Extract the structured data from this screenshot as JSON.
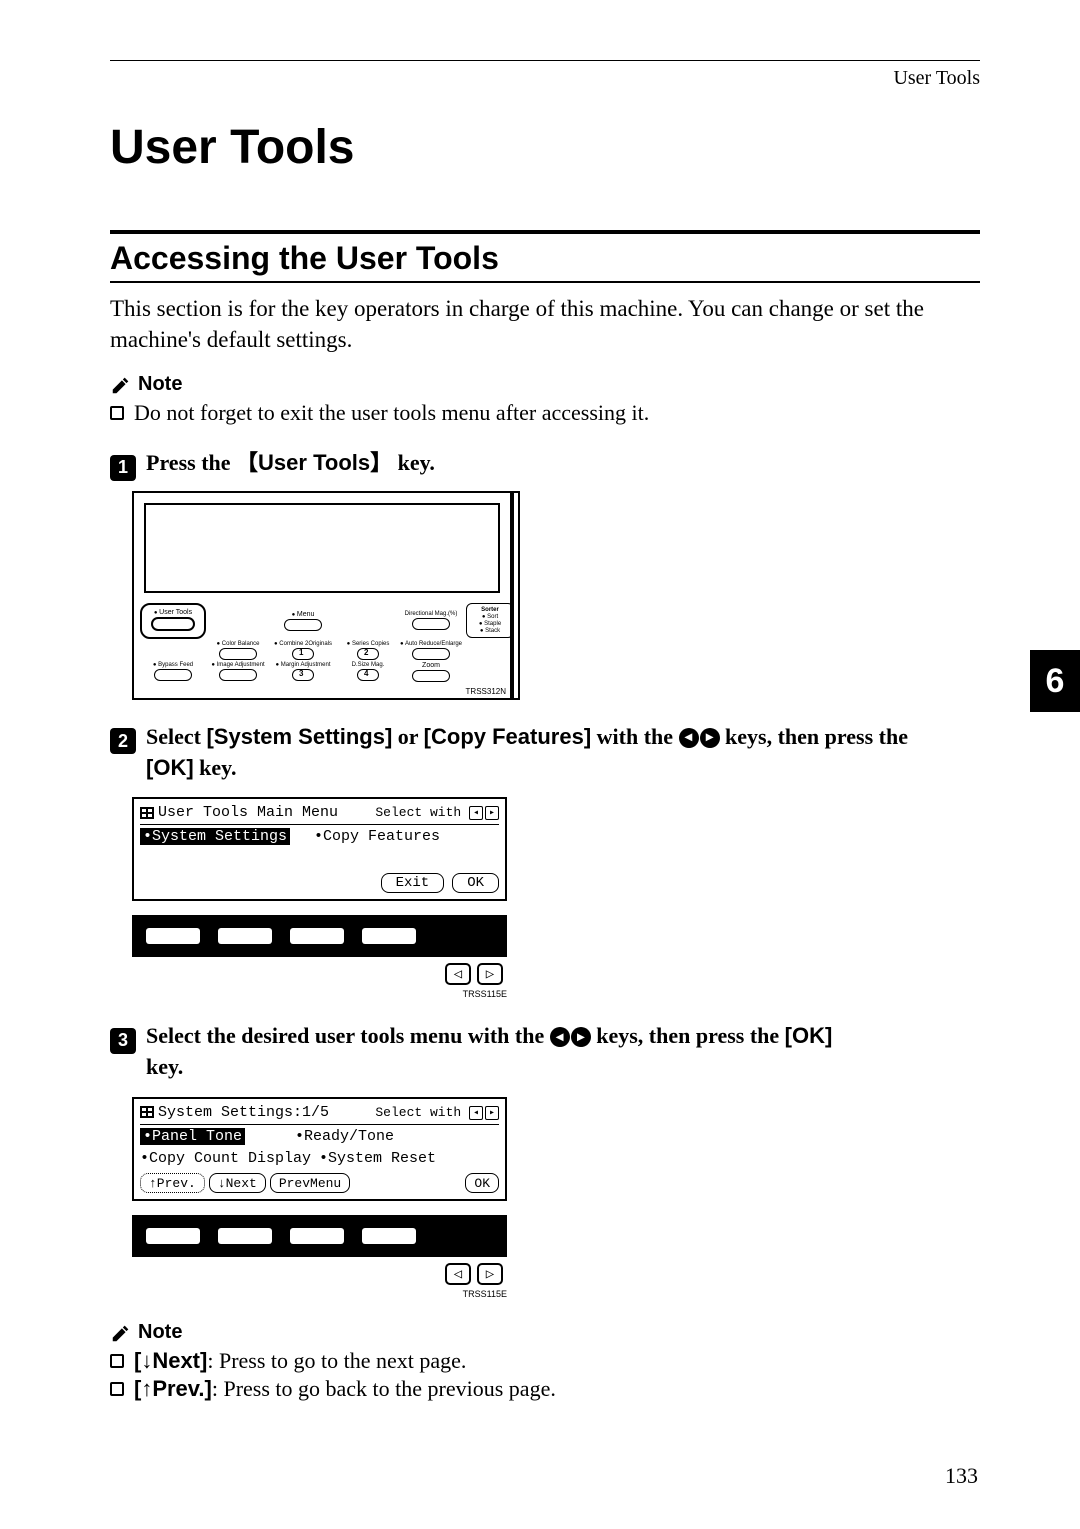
{
  "running_head": "User Tools",
  "h1": "User Tools",
  "h2": "Accessing the User Tools",
  "intro": "This section is for the key operators in charge of this machine. You can change or set the machine's default settings.",
  "note_label": "Note",
  "note1_item": "Do not forget to exit the user tools menu after accessing it.",
  "step1": {
    "num": "1",
    "pre": "Press the ",
    "key": "User Tools",
    "post": " key."
  },
  "panel": {
    "ref": "TRSS312N",
    "usertools": "User Tools",
    "menu": "Menu",
    "color_balance": "Color Balance",
    "combine": "Combine 2Originals",
    "series_copies": "Series Copies",
    "bypass_feed": "Bypass Feed",
    "image_adj": "Image Adjustment",
    "margin_adj": "Margin Adjustment",
    "dsize": "D.Size Mag.",
    "zoom": "Zoom",
    "directional": "Directional Mag.(%)",
    "auto_reduce": "Auto Reduce/Enlarge",
    "sorter": "Sorter",
    "sort": "Sort",
    "staple": "Staple",
    "stack": "Stack",
    "n1": "1",
    "n2": "2",
    "n3": "3",
    "n4": "4"
  },
  "step2": {
    "num": "2",
    "t1": "Select ",
    "sys": "[System Settings]",
    "t2": " or ",
    "copy": "[Copy Features]",
    "t3": " with the ",
    "t4": " keys, then press the ",
    "ok": "[OK]",
    "t5": " key."
  },
  "lcd1": {
    "title": "User Tools Main Menu",
    "select_with": "Select with",
    "item_sys": "•System Settings",
    "item_copy": "•Copy Features",
    "btn_exit": "Exit",
    "btn_ok": "OK",
    "ref": "TRSS115E"
  },
  "step3": {
    "num": "3",
    "t1": "Select the desired user tools menu with the ",
    "t2": " keys, then press the ",
    "ok": "[OK]",
    "t3": " key."
  },
  "lcd2": {
    "title": "System Settings:1/5",
    "select_with": "Select with",
    "item_panel": "•Panel Tone",
    "item_ready": "•Ready/Tone",
    "item_count": "•Copy Count Display",
    "item_reset": "•System Reset",
    "btn_prevp": "↑Prev.",
    "btn_next": "↓Next",
    "btn_prevmenu": "PrevMenu",
    "btn_ok": "OK",
    "ref": "TRSS115E"
  },
  "note2": {
    "next_key": "[↓Next]",
    "next_txt": ": Press to go to the next page.",
    "prev_key": "[↑Prev.]",
    "prev_txt": ": Press to go back to the previous page."
  },
  "chapter": "6",
  "page_num": "133"
}
